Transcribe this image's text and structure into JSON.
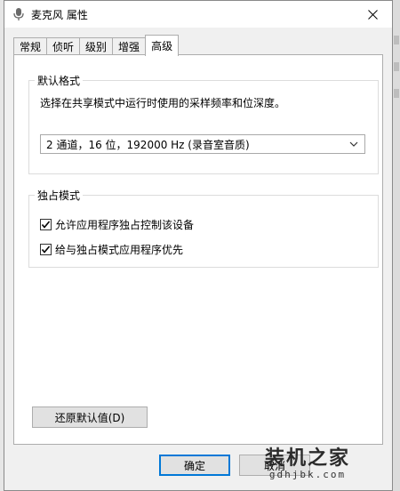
{
  "window": {
    "title": "麦克风 属性"
  },
  "tabs": [
    {
      "label": "常规"
    },
    {
      "label": "侦听"
    },
    {
      "label": "级别"
    },
    {
      "label": "增强"
    },
    {
      "label": "高级"
    }
  ],
  "default_format": {
    "legend": "默认格式",
    "description": "选择在共享模式中运行时使用的采样频率和位深度。",
    "selected_value": "2 通道，16 位，192000 Hz (录音室音质)"
  },
  "exclusive_mode": {
    "legend": "独占模式",
    "options": [
      {
        "label": "允许应用程序独占控制该设备",
        "checked": true
      },
      {
        "label": "给与独占模式应用程序优先",
        "checked": true
      }
    ]
  },
  "buttons": {
    "restore": "还原默认值(D)",
    "ok": "确定",
    "cancel": "取消"
  },
  "watermark": {
    "main": "装机之家",
    "sub": "gdhjbk.com"
  },
  "colors": {
    "accent": "#0078d7",
    "window_bg": "#f0f0f0",
    "panel_bg": "#ffffff"
  }
}
